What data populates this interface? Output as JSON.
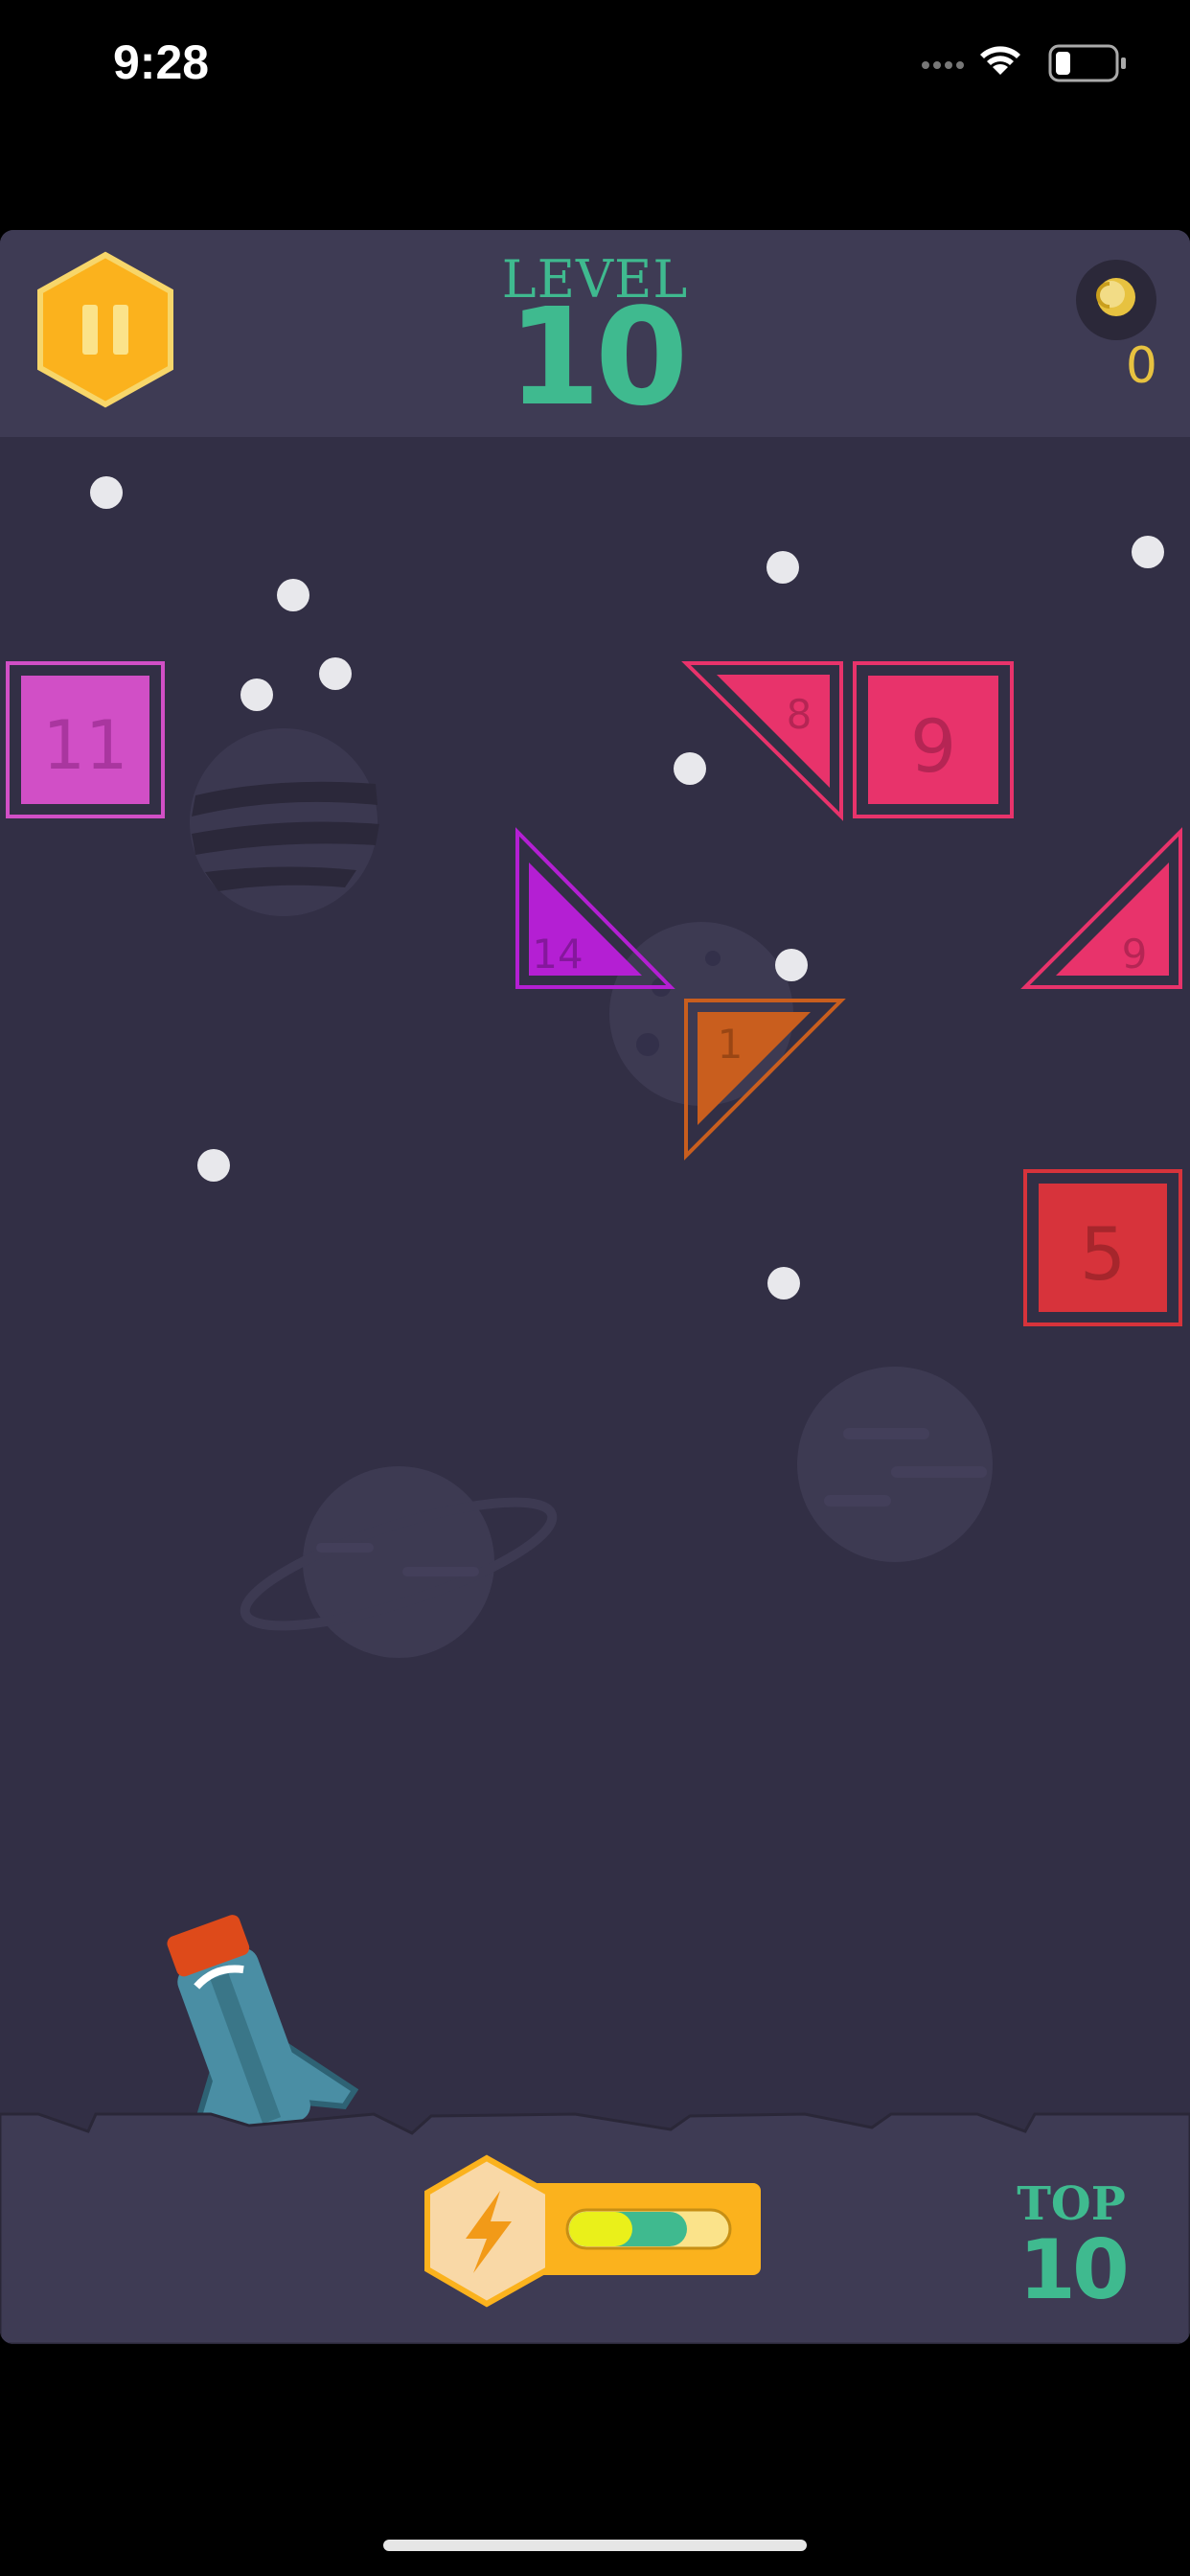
{
  "status_bar": {
    "time": "9:28",
    "icons": [
      "signal-dots-icon",
      "wifi-icon",
      "battery-icon"
    ]
  },
  "hud": {
    "pause_icon": "pause-hexagon-icon",
    "level_label": "LEVEL",
    "level_number": "10",
    "coin_icon": "coin-icon",
    "coin_count": "0"
  },
  "blocks": [
    {
      "shape": "square",
      "value": "11",
      "color": "#d14fc6"
    },
    {
      "shape": "triangle",
      "value": "8",
      "color": "#e8336b"
    },
    {
      "shape": "square",
      "value": "9",
      "color": "#e8336b"
    },
    {
      "shape": "triangle",
      "value": "14",
      "color": "#b41fd3"
    },
    {
      "shape": "triangle",
      "value": "9",
      "color": "#e8336b"
    },
    {
      "shape": "triangle",
      "value": "1",
      "color": "#c95e1e"
    },
    {
      "shape": "square",
      "value": "5",
      "color": "#d7333b"
    }
  ],
  "bottom_bar": {
    "boost_icon": "lightning-icon",
    "boost_fill": 0.4,
    "top_label": "TOP",
    "top_value": "10"
  },
  "colors": {
    "background": "#322f45",
    "hud": "#3e3b54",
    "accent_green": "#3fba8f",
    "pause_orange": "#fbb21d",
    "coin_gold": "#e7c240"
  }
}
